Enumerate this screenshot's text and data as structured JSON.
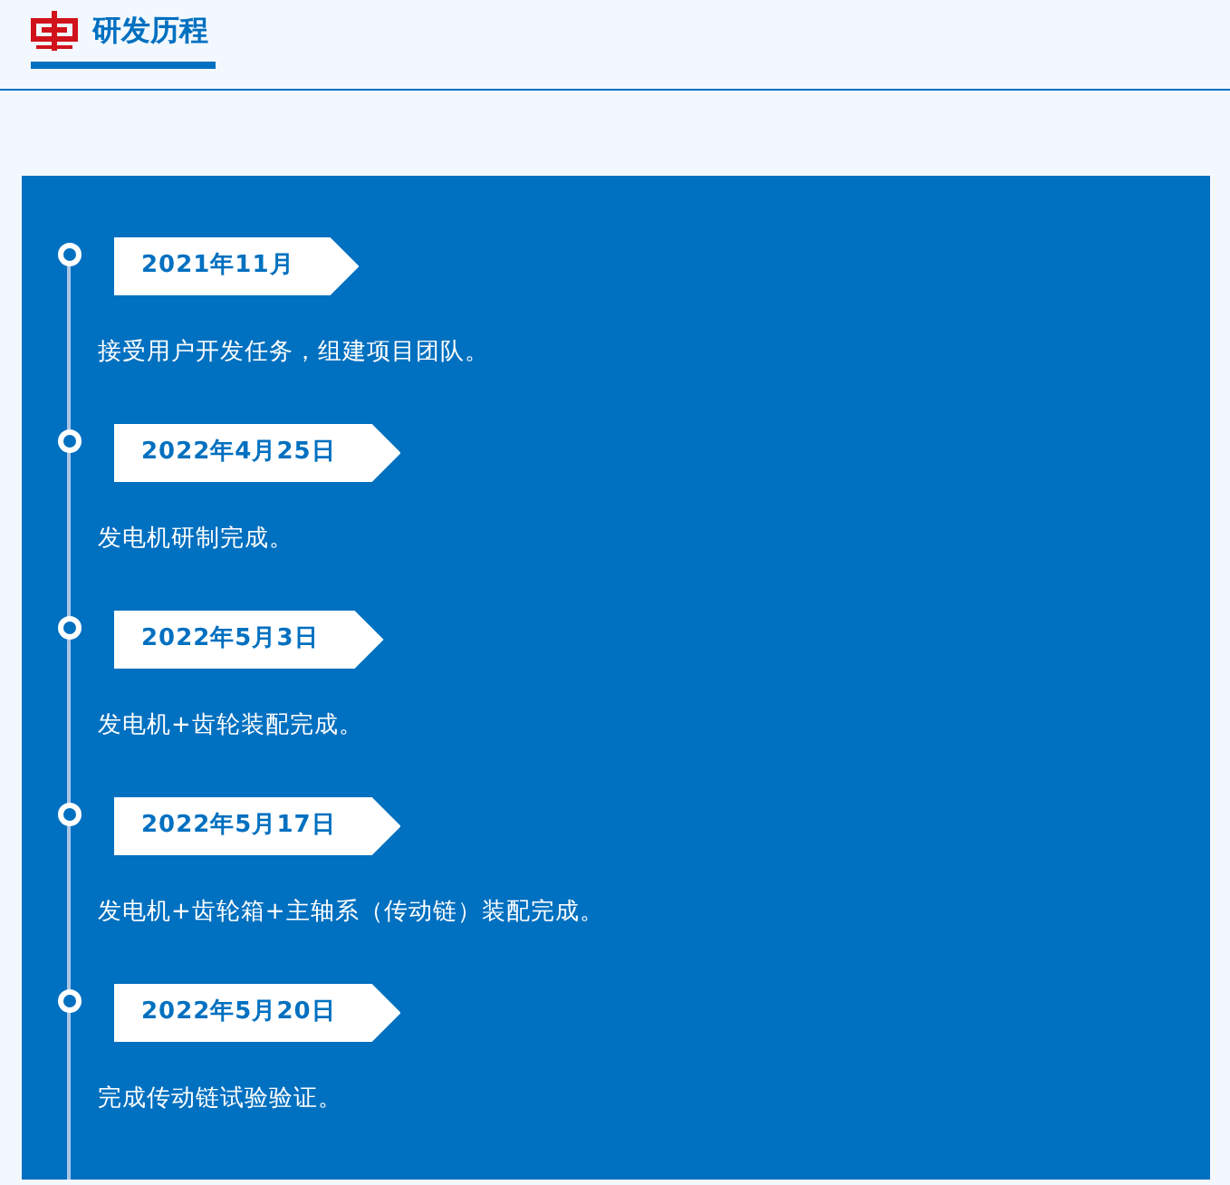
{
  "header": {
    "title": "研发历程"
  },
  "timeline": [
    {
      "date": "2021年11月",
      "text": "接受用户开发任务，组建项目团队。"
    },
    {
      "date": "2022年4月25日",
      "text": "发电机研制完成。"
    },
    {
      "date": "2022年5月3日",
      "text": "发电机+齿轮装配完成。"
    },
    {
      "date": "2022年5月17日",
      "text": "发电机+齿轮箱+主轴系（传动链）装配完成。"
    },
    {
      "date": "2022年5月20日",
      "text": "完成传动链试验验证。"
    }
  ]
}
